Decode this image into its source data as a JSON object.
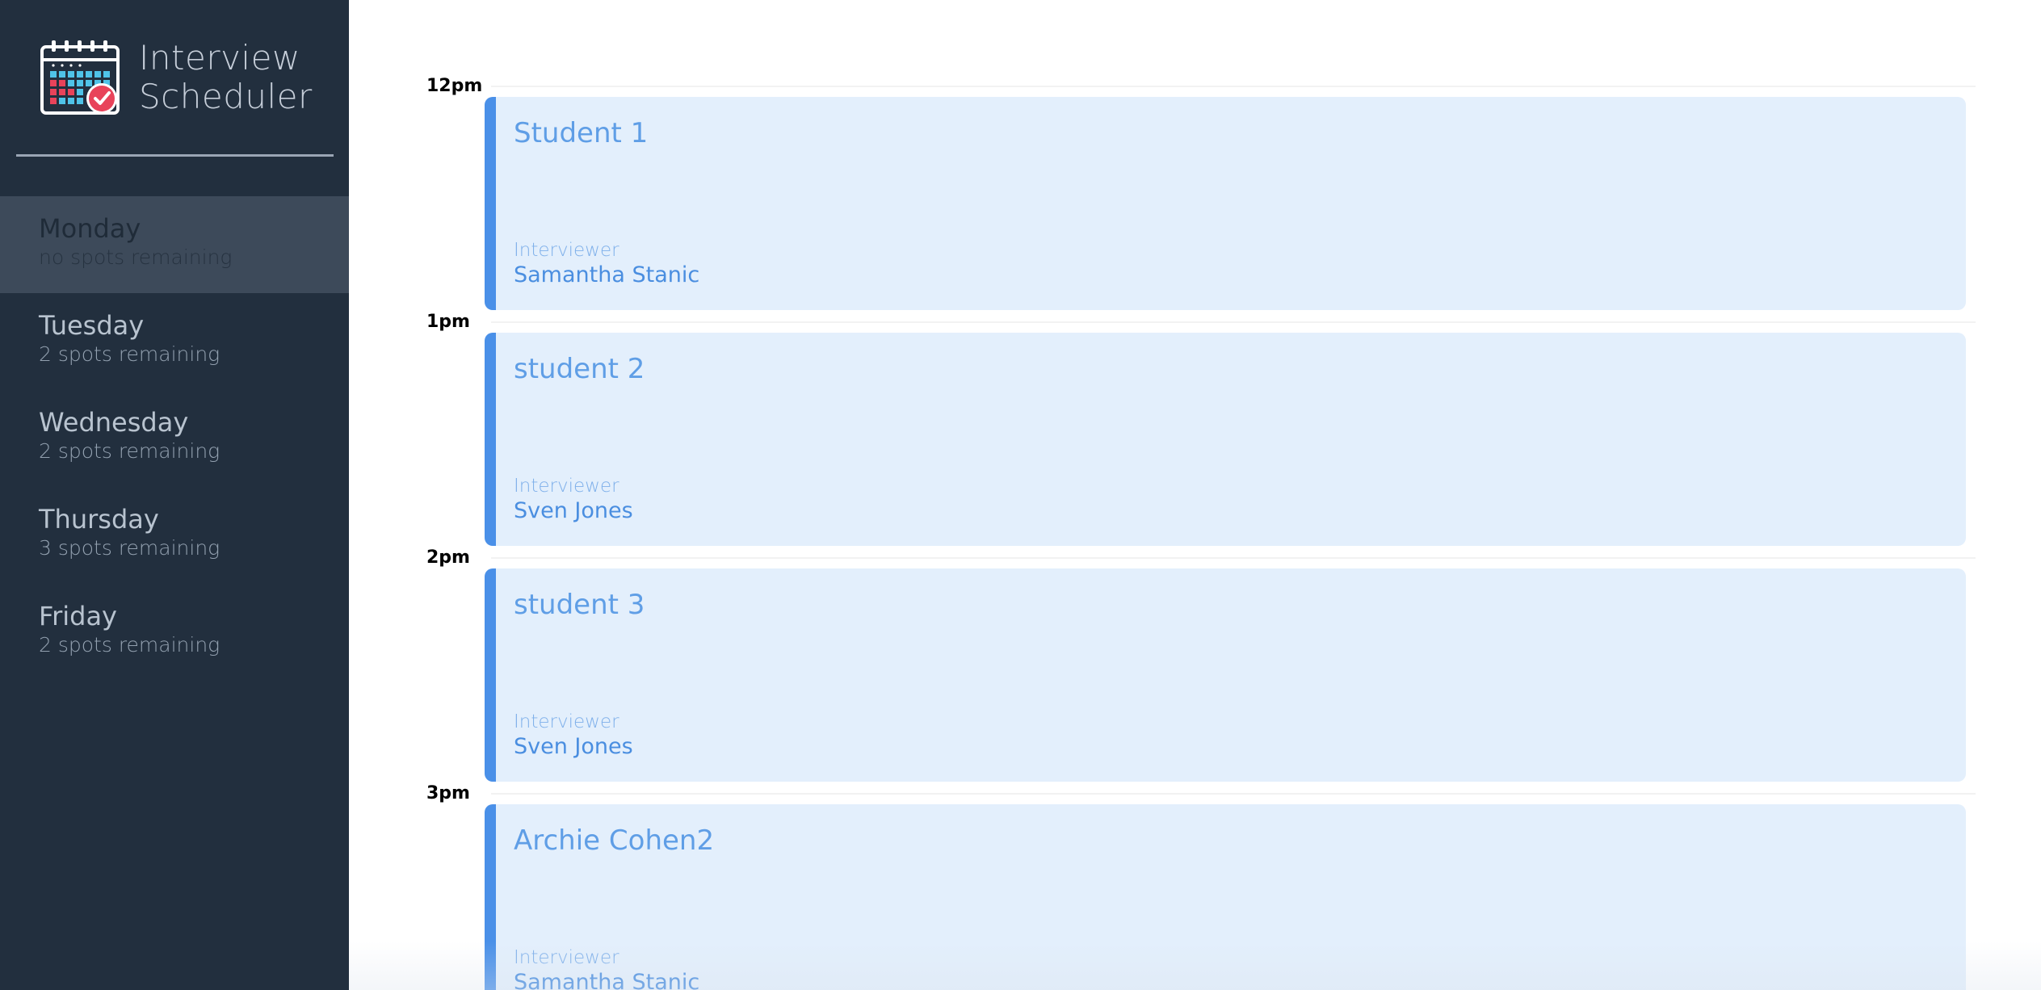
{
  "brand": {
    "line1": "Interview",
    "line2": "Scheduler",
    "logo_icon": "calendar-check-icon",
    "logo_colors": {
      "frame": "#ffffff",
      "cells_blue": "#4fc3e8",
      "cells_red": "#e8435a",
      "badge": "#e8435a"
    }
  },
  "days": [
    {
      "name": "Monday",
      "spots": "no spots remaining",
      "selected": true
    },
    {
      "name": "Tuesday",
      "spots": "2 spots remaining",
      "selected": false
    },
    {
      "name": "Wednesday",
      "spots": "2 spots remaining",
      "selected": false
    },
    {
      "name": "Thursday",
      "spots": "3 spots remaining",
      "selected": false
    },
    {
      "name": "Friday",
      "spots": "2 spots remaining",
      "selected": false
    }
  ],
  "appointments": [
    {
      "time": "12pm",
      "student": "Student 1",
      "interviewer_label": "Interviewer",
      "interviewer": "Samantha Stanic"
    },
    {
      "time": "1pm",
      "student": "student 2",
      "interviewer_label": "Interviewer",
      "interviewer": "Sven Jones"
    },
    {
      "time": "2pm",
      "student": "student 3",
      "interviewer_label": "Interviewer",
      "interviewer": "Sven Jones"
    },
    {
      "time": "3pm",
      "student": "Archie Cohen2",
      "interviewer_label": "Interviewer",
      "interviewer": "Samantha Stanic"
    }
  ],
  "colors": {
    "sidebar": "#222f3e",
    "selected_day": "#3d4a5a",
    "card_bg": "#e3effc",
    "card_accent": "#4a90e8",
    "card_text": "#5f9ee6"
  }
}
